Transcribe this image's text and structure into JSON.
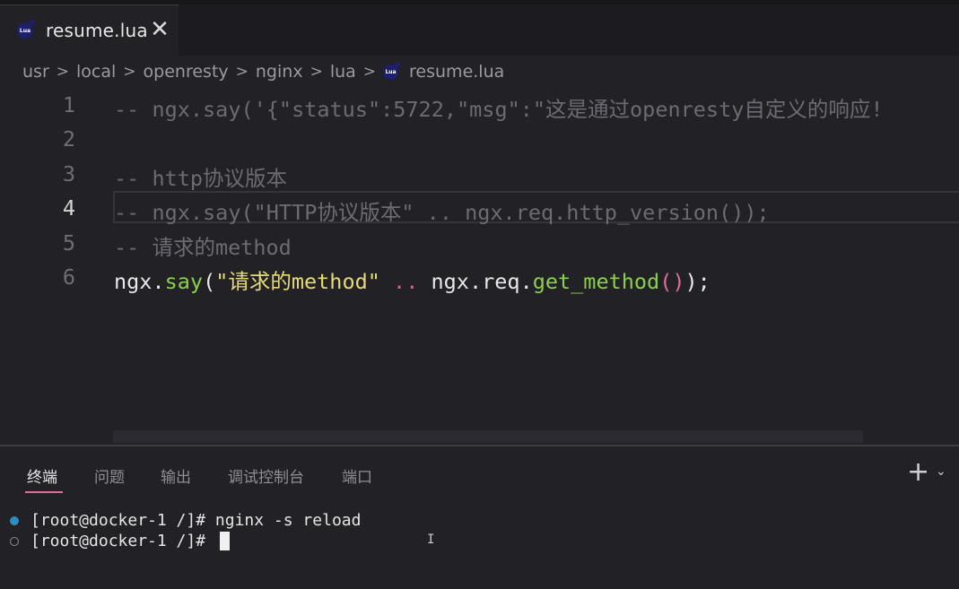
{
  "tab": {
    "icon": "lua-file-icon",
    "icon_text": "Lua",
    "title": "resume.lua",
    "close_glyph": "✕"
  },
  "breadcrumb": {
    "segments": [
      "usr",
      "local",
      "openresty",
      "nginx",
      "lua"
    ],
    "separator": ">",
    "file": "resume.lua"
  },
  "editor": {
    "active_line": 4,
    "lines": [
      {
        "number": "1",
        "text": "-- ngx.say('{\"status\":5722,\"msg\":\"这是通过openresty自定义的响应!"
      },
      {
        "number": "2",
        "text": ""
      },
      {
        "number": "3",
        "text": "-- http协议版本"
      },
      {
        "number": "4",
        "text": "-- ngx.say(\"HTTP协议版本\" .. ngx.req.http_version());"
      },
      {
        "number": "5",
        "text": "-- 请求的method"
      },
      {
        "number": "6",
        "tokens": {
          "obj": "ngx",
          "dot1": ".",
          "fn": "say",
          "open": "(",
          "str": "\"请求的method\"",
          "concat": " .. ",
          "obj2": "ngx",
          "dot2": ".",
          "req": "req",
          "dot3": ".",
          "fn2": "get_method",
          "parens": "()",
          "close": ")",
          "semi": ";"
        }
      }
    ]
  },
  "panel": {
    "tabs": [
      "终端",
      "问题",
      "输出",
      "调试控制台",
      "端口"
    ],
    "active_tab": "终端",
    "plus_glyph": "+",
    "chevron_glyph": "⌄"
  },
  "terminal": {
    "lines": [
      {
        "status": "completed",
        "text": "[root@docker-1 /]# nginx -s reload"
      },
      {
        "status": "pending",
        "text": "[root@docker-1 /]# "
      }
    ]
  },
  "colors": {
    "background": "#212126",
    "comment": "#6b6b73",
    "string": "#e6db74",
    "function": "#8ccf4d",
    "operator": "#e05a82",
    "accent_underline": "#e06c9f",
    "terminal_success_dot": "#2f8cc0"
  }
}
